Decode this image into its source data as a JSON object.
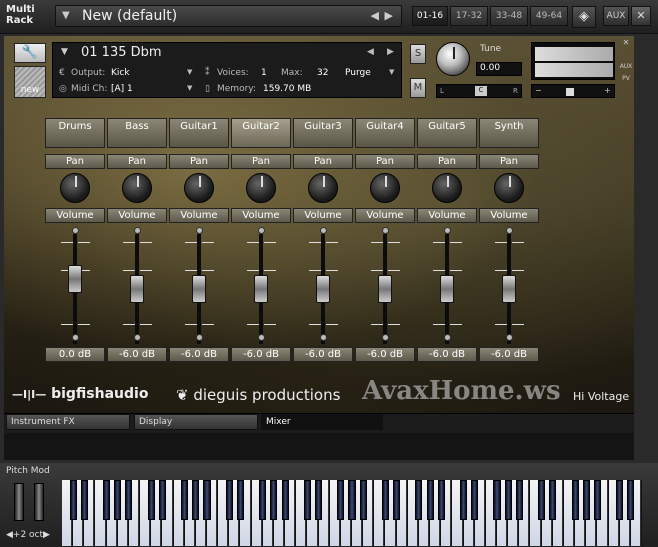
{
  "rack": {
    "label": "Multi\nRack",
    "preset_name": "New (default)",
    "prev": "◀",
    "next": "▶",
    "tabs": [
      "01-16",
      "17-32",
      "33-48",
      "49-64"
    ],
    "aux": "AUX"
  },
  "instrument": {
    "name": "01 135 Dbm",
    "output_label": "Output:",
    "output_value": "Kick",
    "voices_label": "Voices:",
    "voices_value": "1",
    "max_label": "Max:",
    "max_value": "32",
    "purge": "Purge",
    "midi_label": "Midi Ch:",
    "midi_value": "[A] 1",
    "memory_label": "Memory:",
    "memory_value": "159.70 MB",
    "new_label": "new",
    "solo": "S",
    "mute": "M",
    "tune_label": "Tune",
    "tune_value": "0.00",
    "pan_left": "L",
    "pan_center": "C",
    "pan_right": "R",
    "side_aux": "AUX",
    "side_pv": "PV"
  },
  "mixer": {
    "pan_label": "Pan",
    "volume_label": "Volume",
    "channels": [
      {
        "name": "Drums",
        "db": "0.0 dB",
        "fader": 0.62
      },
      {
        "name": "Bass",
        "db": "-6.0 dB",
        "fader": 0.5
      },
      {
        "name": "Guitar1",
        "db": "-6.0 dB",
        "fader": 0.5
      },
      {
        "name": "Guitar2",
        "db": "-6.0 dB",
        "fader": 0.5
      },
      {
        "name": "Guitar3",
        "db": "-6.0 dB",
        "fader": 0.5
      },
      {
        "name": "Guitar4",
        "db": "-6.0 dB",
        "fader": 0.5
      },
      {
        "name": "Guitar5",
        "db": "-6.0 dB",
        "fader": 0.5
      },
      {
        "name": "Synth",
        "db": "-6.0 dB",
        "fader": 0.5
      }
    ]
  },
  "branding": {
    "bigfish": "bigfishaudio",
    "dieguis": "dieguis productions",
    "watermark": "AvaxHome.ws",
    "product": "Hi Voltage"
  },
  "panel_tabs": [
    "Instrument FX",
    "Display",
    "Mixer"
  ],
  "keyboard": {
    "pitch_mod": "Pitch Mod",
    "octave": "+2 oct"
  }
}
